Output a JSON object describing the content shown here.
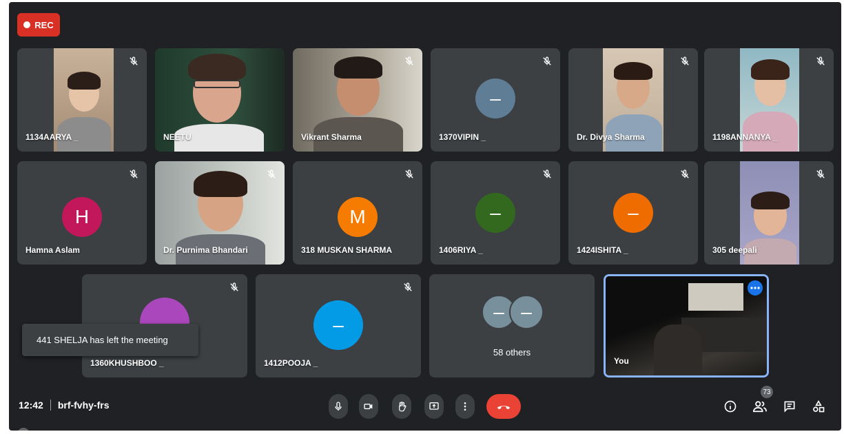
{
  "recording": {
    "label": "REC",
    "color": "#d93025"
  },
  "tiles": [
    {
      "name": "1134AARYA _"
    },
    {
      "name": "NEETU"
    },
    {
      "name": "Vikrant Sharma"
    },
    {
      "name": "1370VIPIN _",
      "avatar": "–",
      "avatar_color": "#5f7d95"
    },
    {
      "name": "Dr. Divya Sharma"
    },
    {
      "name": "1198ANNANYA _"
    },
    {
      "name": "Hamna Aslam",
      "avatar": "H",
      "avatar_color": "#c2185b"
    },
    {
      "name": "Dr. Purnima Bhandari"
    },
    {
      "name": "318 MUSKAN SHARMA",
      "avatar": "M",
      "avatar_color": "#f57c00"
    },
    {
      "name": "1406RIYA _",
      "avatar": "–",
      "avatar_color": "#33691e"
    },
    {
      "name": "1424ISHITA _",
      "avatar": "–",
      "avatar_color": "#ef6c00"
    },
    {
      "name": "305 deepali"
    },
    {
      "name": "1360KHUSHBOO _",
      "avatar_color": "#ab47bc"
    },
    {
      "name": "1412POOJA _",
      "avatar": "–",
      "avatar_color": "#039be5"
    },
    {
      "name": "58 others",
      "avatar": "–",
      "avatar_color": "#78909c"
    },
    {
      "name": "You"
    }
  ],
  "toast": {
    "text": "441 SHELJA has left the meeting"
  },
  "meeting": {
    "time": "12:42",
    "code": "brf-fvhy-frs"
  },
  "participants_count": "73",
  "colors": {
    "end_call": "#ea4335",
    "background": "#202124",
    "tile": "#3c4043",
    "highlight": "#8ab4f8"
  }
}
